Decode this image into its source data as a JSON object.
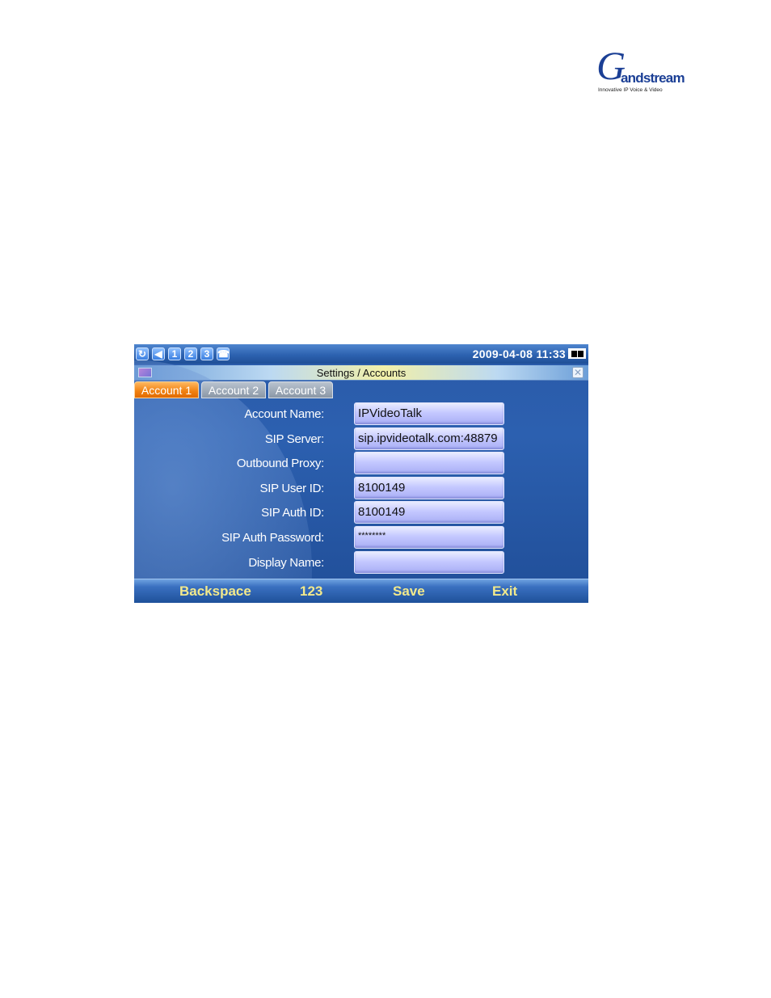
{
  "logo": {
    "initial": "G",
    "wordmark": "andstream",
    "tagline": "Innovative IP Voice & Video"
  },
  "status_bar": {
    "icons": [
      "refresh-icon",
      "volume-icon",
      "line-1-icon",
      "line-2-icon",
      "line-3-icon",
      "hook-icon"
    ],
    "line_numbers": [
      "1",
      "2",
      "3"
    ],
    "datetime": "2009-04-08 11:33",
    "battery_icon": "battery-icon"
  },
  "window": {
    "title": "Settings / Accounts",
    "close_icon": "close-icon"
  },
  "tabs": [
    {
      "label": "Account 1",
      "active": true
    },
    {
      "label": "Account 2",
      "active": false
    },
    {
      "label": "Account 3",
      "active": false
    }
  ],
  "form": {
    "fields": [
      {
        "label": "Account Name:",
        "value": "IPVideoTalk"
      },
      {
        "label": "SIP Server:",
        "value": "sip.ipvideotalk.com:48879"
      },
      {
        "label": "Outbound Proxy:",
        "value": ""
      },
      {
        "label": "SIP User ID:",
        "value": "8100149"
      },
      {
        "label": "SIP Auth ID:",
        "value": "8100149"
      },
      {
        "label": "SIP Auth Password:",
        "value": "********"
      },
      {
        "label": "Display Name:",
        "value": ""
      }
    ]
  },
  "softkeys": {
    "backspace": "Backspace",
    "mode": "123",
    "save": "Save",
    "exit": "Exit"
  },
  "colors": {
    "screen_background": "#2c60b0",
    "active_tab": "#f08010",
    "softkey_text": "#f2e98c"
  }
}
